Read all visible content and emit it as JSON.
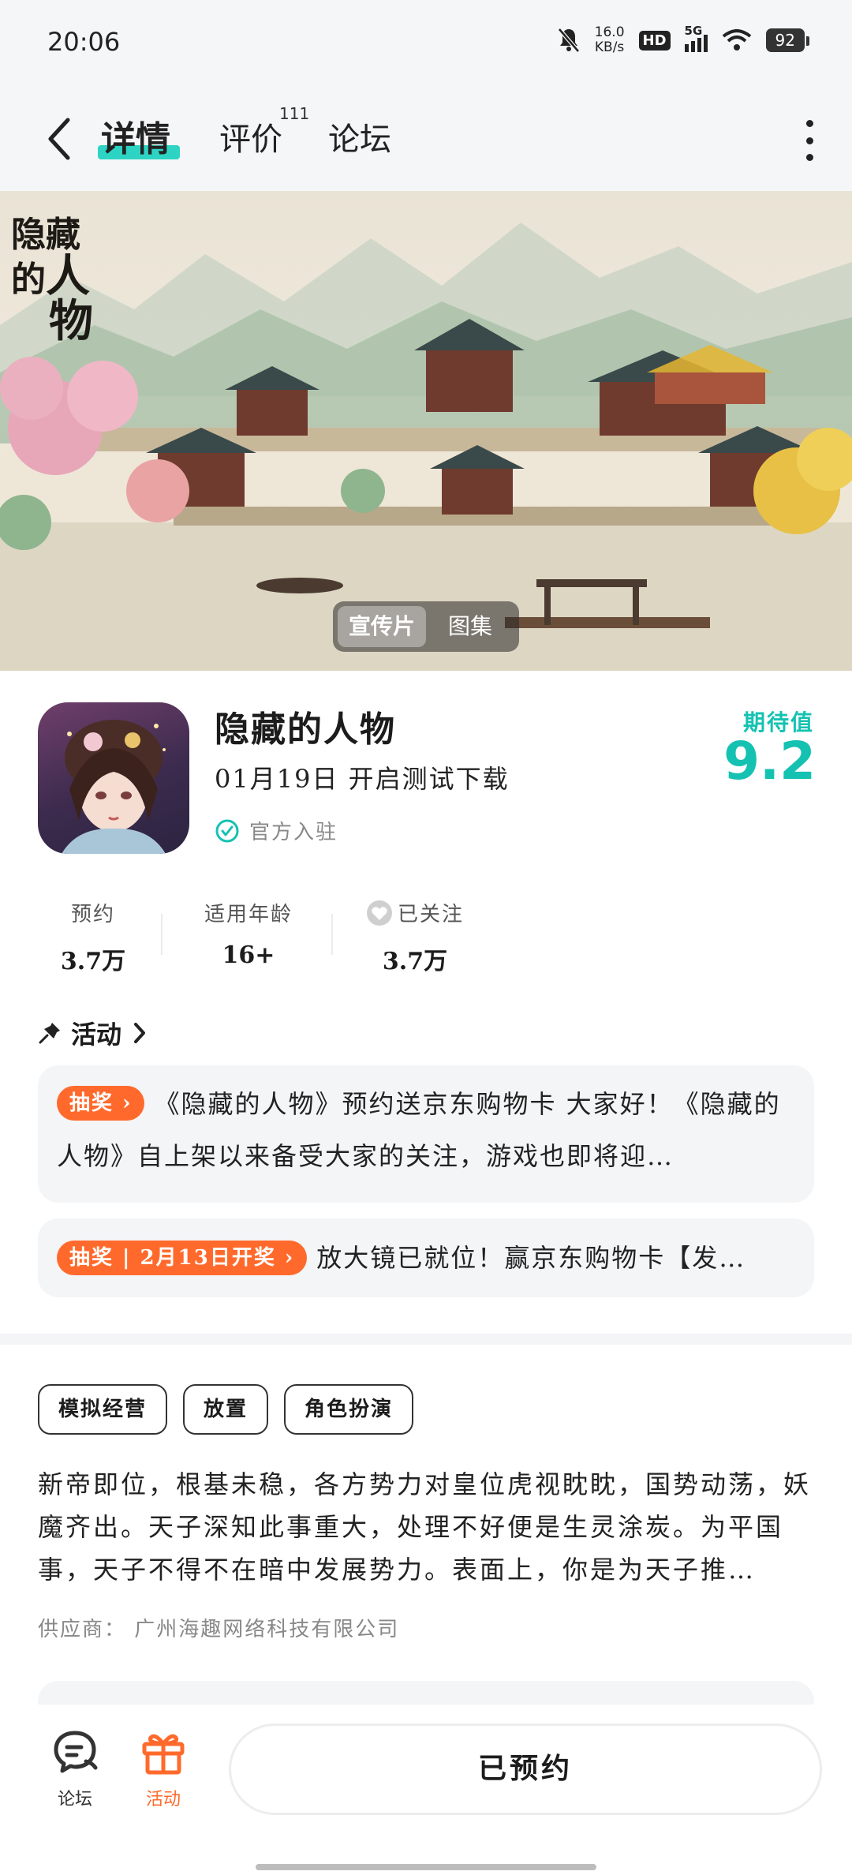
{
  "status_bar": {
    "time": "20:06",
    "net_speed_value": "16.0",
    "net_speed_unit": "KB/s",
    "hd": "HD",
    "network": "5G",
    "battery": "92"
  },
  "nav": {
    "tabs": [
      {
        "label": "详情",
        "active": true
      },
      {
        "label": "评价",
        "count": "111"
      },
      {
        "label": "论坛"
      }
    ]
  },
  "banner": {
    "title_chars": [
      "隐",
      "藏",
      "的",
      "人",
      "物"
    ],
    "media_tabs": [
      "宣传片",
      "图集"
    ]
  },
  "game": {
    "name": "隐藏的人物",
    "release": "01月19日 开启测试下载",
    "official": "官方入驻",
    "expect_label": "期待值",
    "expect_score": "9.2"
  },
  "stats": [
    {
      "label": "预约",
      "value": "3.7万"
    },
    {
      "label": "适用年龄",
      "value": "16+"
    },
    {
      "label": "已关注",
      "value": "3.7万"
    }
  ],
  "activities": {
    "title": "活动",
    "items": [
      {
        "badge": "抽奖",
        "text": "《隐藏的人物》预约送京东购物卡 大家好！《隐藏的人物》自上架以来备受大家的关注，游戏也即将迎…"
      },
      {
        "badge": "抽奖 | 2月13日开奖",
        "text": "放大镜已就位！赢京东购物卡【发…"
      }
    ]
  },
  "tags": [
    "模拟经营",
    "放置",
    "角色扮演"
  ],
  "description": "新帝即位，根基未稳，各方势力对皇位虎视眈眈，国势动荡，妖魔齐出。天子深知此事重大，处理不好便是生灵涂炭。为平国事，天子不得不在暗中发展势力。表面上，你是为天子推…",
  "supplier": "供应商：  广州海趣网络科技有限公司",
  "bottom_bar": {
    "forum": "论坛",
    "activity": "活动",
    "reserve": "已预约"
  },
  "colors": {
    "accent_teal": "#15c2b2",
    "accent_orange": "#ff6a2c"
  }
}
